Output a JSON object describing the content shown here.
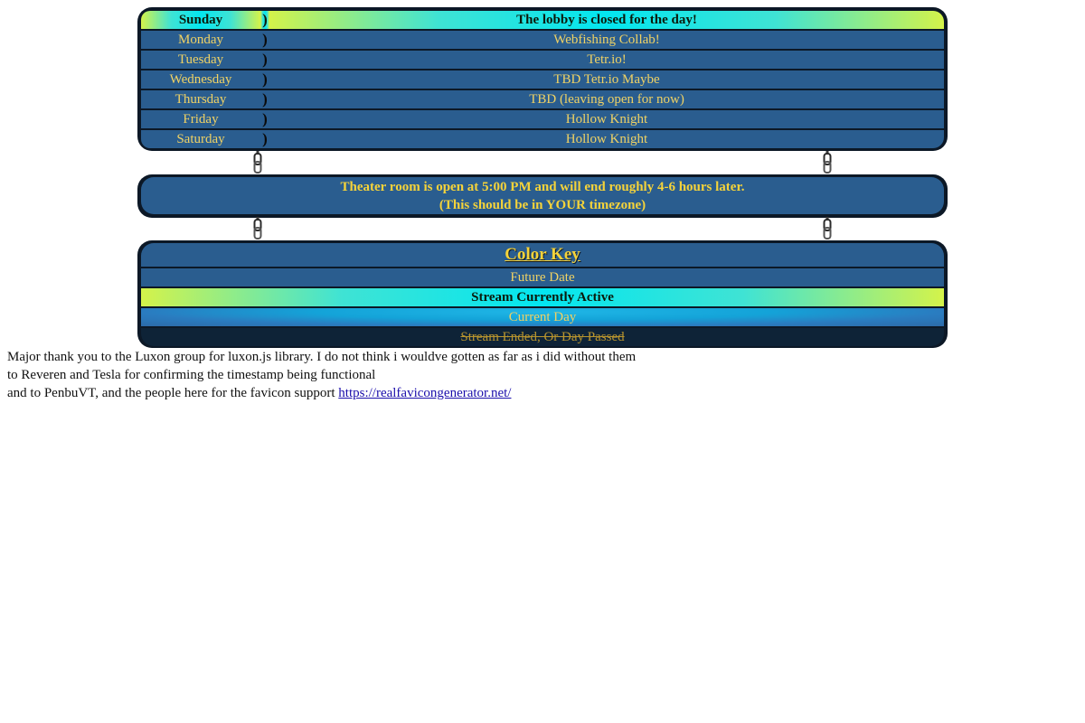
{
  "schedule": [
    {
      "day": "Sunday",
      "event": "The lobby is closed for the day!",
      "state": "active"
    },
    {
      "day": "Monday",
      "event": "Webfishing Collab!",
      "state": "future"
    },
    {
      "day": "Tuesday",
      "event": "Tetr.io!",
      "state": "future"
    },
    {
      "day": "Wednesday",
      "event": "TBD Tetr.io Maybe",
      "state": "future"
    },
    {
      "day": "Thursday",
      "event": "TBD (leaving open for now)",
      "state": "future"
    },
    {
      "day": "Friday",
      "event": "Hollow Knight",
      "state": "future"
    },
    {
      "day": "Saturday",
      "event": "Hollow Knight",
      "state": "future"
    }
  ],
  "bracket_glyph": ")",
  "theater": {
    "line1": "Theater room is open at 5:00 PM and will end roughly 4-6 hours later.",
    "line2": "(This should be in YOUR timezone)"
  },
  "color_key": {
    "title": "Color Key",
    "future": "Future Date",
    "active": "Stream Currently Active",
    "current": "Current Day",
    "passed": "Stream Ended, Or Day Passed"
  },
  "credits": {
    "line1": "Major thank you to the Luxon group for luxon.js library. I do not think i wouldve gotten as far as i did without them",
    "line2": "to Reveren and Tesla for confirming the timestamp being functional",
    "line3": "and to PenbuVT, and the people here for the favicon support",
    "link": "https://realfavicongenerator.net/"
  },
  "colors": {
    "panel_bg": "#2a5d8f",
    "frame": "#0c1826",
    "text_gold": "#f0d264",
    "active_gradient_edge": "#d4f34a",
    "active_gradient_center": "#03e6f0"
  }
}
